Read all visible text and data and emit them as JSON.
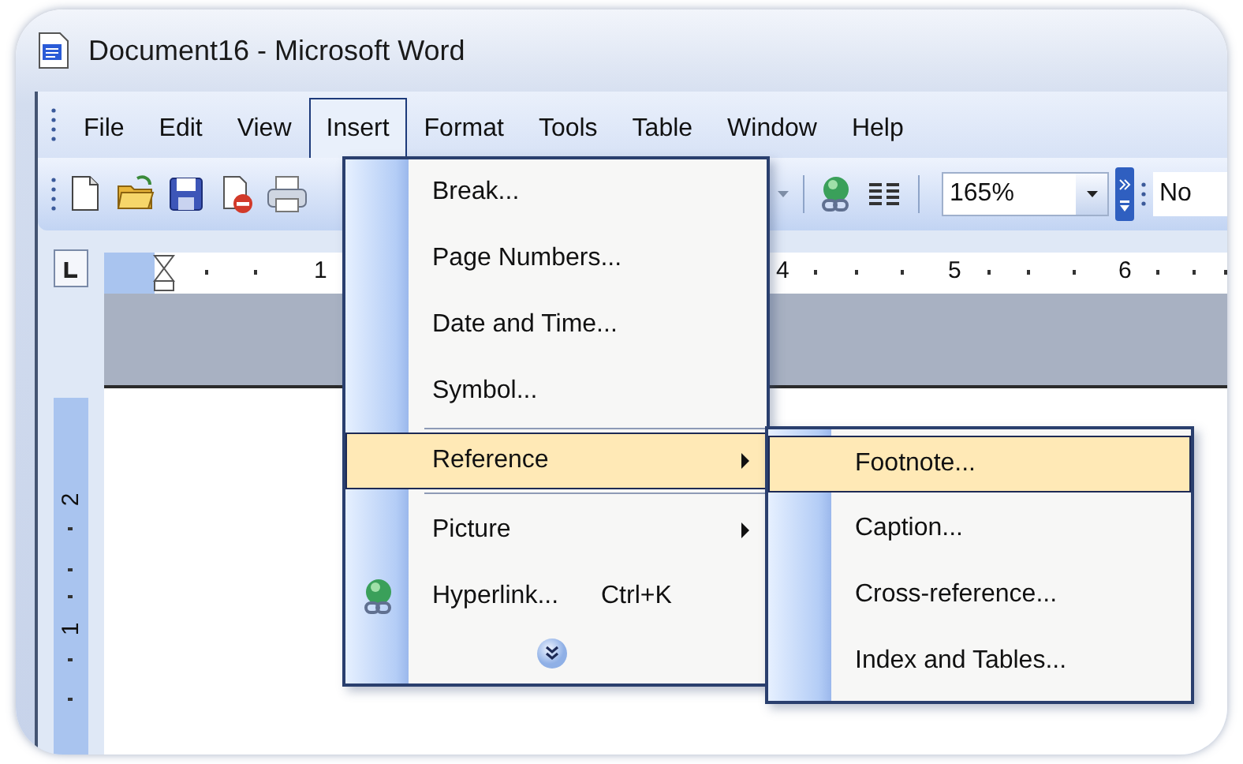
{
  "window": {
    "title": "Document16 - Microsoft Word"
  },
  "menu_bar": [
    {
      "label": "File",
      "selected": false
    },
    {
      "label": "Edit",
      "selected": false
    },
    {
      "label": "View",
      "selected": false
    },
    {
      "label": "Insert",
      "selected": true
    },
    {
      "label": "Format",
      "selected": false
    },
    {
      "label": "Tools",
      "selected": false
    },
    {
      "label": "Table",
      "selected": false
    },
    {
      "label": "Window",
      "selected": false
    },
    {
      "label": "Help",
      "selected": false
    }
  ],
  "toolbar": {
    "zoom": "165%",
    "style": "No"
  },
  "ruler": {
    "horizontal_labels": [
      "1",
      "4",
      "5",
      "6"
    ],
    "vertical_labels": [
      "2",
      "1"
    ]
  },
  "insert_menu": {
    "items": [
      {
        "label": "Break...",
        "has_submenu": false,
        "selected": false,
        "separator_above": false
      },
      {
        "label": "Page Numbers...",
        "has_submenu": false,
        "selected": false,
        "separator_above": false
      },
      {
        "label": "Date and Time...",
        "has_submenu": false,
        "selected": false,
        "separator_above": false
      },
      {
        "label": "Symbol...",
        "has_submenu": false,
        "selected": false,
        "separator_above": false
      },
      {
        "label": "Reference",
        "has_submenu": true,
        "selected": true,
        "separator_above": true
      },
      {
        "label": "Picture",
        "has_submenu": true,
        "selected": false,
        "separator_above": true
      },
      {
        "label": "Hyperlink...",
        "shortcut": "Ctrl+K",
        "has_submenu": false,
        "selected": false,
        "separator_above": false
      }
    ]
  },
  "reference_submenu": {
    "items": [
      {
        "label": "Footnote...",
        "selected": true
      },
      {
        "label": "Caption...",
        "selected": false
      },
      {
        "label": "Cross-reference...",
        "selected": false
      },
      {
        "label": "Index and Tables...",
        "selected": false
      }
    ]
  }
}
